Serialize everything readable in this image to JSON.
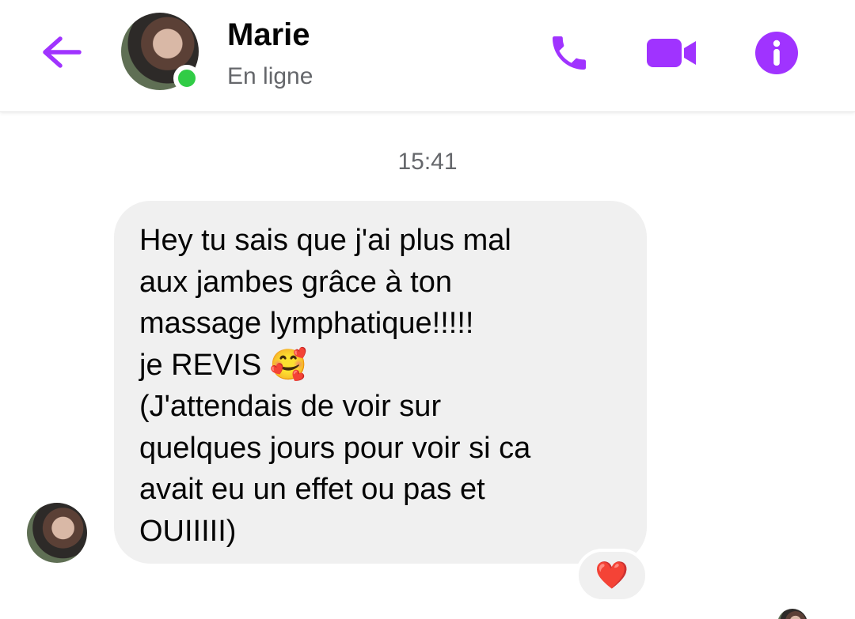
{
  "header": {
    "contact_name": "Marie",
    "status": "En ligne",
    "back_icon": "arrow-left-icon",
    "actions": [
      "phone-icon",
      "video-camera-icon",
      "info-icon"
    ],
    "accent_color": "#a033ff",
    "presence_color": "#31cc46"
  },
  "conversation": {
    "timestamp": "15:41",
    "messages": [
      {
        "sender": "Marie",
        "text": "Hey tu sais que j'ai plus mal\naux jambes grâce à ton\nmassage lymphatique!!!!!\nje REVIS 🥰\n(J'attendais de voir sur\nquelques jours pour voir si ca\navait eu un effet ou pas et\nOUIIIII)",
        "reaction": "❤️"
      }
    ],
    "bubble_color": "#f0f0f0"
  }
}
